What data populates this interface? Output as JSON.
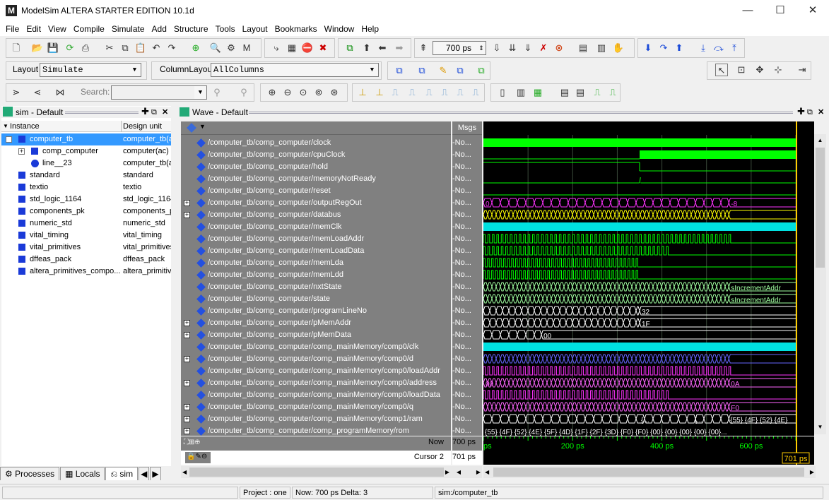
{
  "app": {
    "title": "ModelSim ALTERA STARTER EDITION 10.1d",
    "logo": "M"
  },
  "window_controls": {
    "minimize": "—",
    "maximize": "☐",
    "close": "✕"
  },
  "menu": [
    "File",
    "Edit",
    "View",
    "Compile",
    "Simulate",
    "Add",
    "Structure",
    "Tools",
    "Layout",
    "Bookmarks",
    "Window",
    "Help"
  ],
  "toolbar": {
    "run_length": "700 ps",
    "layout_label": "Layout",
    "layout_value": "Simulate",
    "column_layout_label": "ColumnLayout",
    "column_layout_value": "AllColumns",
    "search_label": "Search:",
    "search_value": ""
  },
  "sim_panel": {
    "title": "sim - Default",
    "col_instance": "Instance",
    "col_design_unit": "Design unit",
    "rows": [
      {
        "instance": "computer_tb",
        "unit": "computer_tb(a",
        "icon": "block",
        "indent": 0,
        "expand": "-",
        "selected": true
      },
      {
        "instance": "comp_computer",
        "unit": "computer(ac)",
        "icon": "block",
        "indent": 1,
        "expand": "+",
        "selected": false
      },
      {
        "instance": "line__23",
        "unit": "computer_tb(a",
        "icon": "process",
        "indent": 1,
        "expand": "",
        "selected": false
      },
      {
        "instance": "standard",
        "unit": "standard",
        "icon": "block",
        "indent": 0,
        "expand": "",
        "selected": false
      },
      {
        "instance": "textio",
        "unit": "textio",
        "icon": "block",
        "indent": 0,
        "expand": "",
        "selected": false
      },
      {
        "instance": "std_logic_1164",
        "unit": "std_logic_1164",
        "icon": "block",
        "indent": 0,
        "expand": "",
        "selected": false
      },
      {
        "instance": "components_pk",
        "unit": "components_p",
        "icon": "block",
        "indent": 0,
        "expand": "",
        "selected": false
      },
      {
        "instance": "numeric_std",
        "unit": "numeric_std",
        "icon": "block",
        "indent": 0,
        "expand": "",
        "selected": false
      },
      {
        "instance": "vital_timing",
        "unit": "vital_timing",
        "icon": "block",
        "indent": 0,
        "expand": "",
        "selected": false
      },
      {
        "instance": "vital_primitives",
        "unit": "vital_primitives",
        "icon": "block",
        "indent": 0,
        "expand": "",
        "selected": false
      },
      {
        "instance": "dffeas_pack",
        "unit": "dffeas_pack",
        "icon": "block",
        "indent": 0,
        "expand": "",
        "selected": false
      },
      {
        "instance": "altera_primitives_compo...",
        "unit": "altera_primitiv",
        "icon": "block",
        "indent": 0,
        "expand": "",
        "selected": false
      }
    ],
    "tabs": [
      "Processes",
      "Locals",
      "sim"
    ]
  },
  "wave": {
    "title": "Wave - Default",
    "msgs_header": "Msgs",
    "now_label": "Now",
    "now_value": "700 ps",
    "cursor_label": "Cursor 2",
    "cursor_value": "701 ps",
    "cursor_flag": "701 ps",
    "time_end_ps": 700,
    "time_labels": [
      "ps",
      "200 ps",
      "400 ps",
      "600 ps"
    ],
    "signals": [
      {
        "name": "/computer_tb/comp_computer/clock",
        "msg": "-No...",
        "expand": false,
        "type": "clockfill",
        "color": "#00ff00"
      },
      {
        "name": "/computer_tb/comp_computer/cpuClock",
        "msg": "-No...",
        "expand": false,
        "type": "late",
        "color": "#00ff00"
      },
      {
        "name": "/computer_tb/comp_computer/hold",
        "msg": "-No...",
        "expand": false,
        "type": "hold",
        "color": "#00ff00"
      },
      {
        "name": "/computer_tb/comp_computer/memoryNotReady",
        "msg": "-No...",
        "expand": false,
        "type": "mnr",
        "color": "#00ff00"
      },
      {
        "name": "/computer_tb/comp_computer/reset",
        "msg": "-No...",
        "expand": false,
        "type": "low",
        "color": "#00ff00"
      },
      {
        "name": "/computer_tb/comp_computer/outputRegOut",
        "msg": "-No...",
        "expand": true,
        "type": "bus",
        "color": "#ff33ff",
        "values": [
          "0",
          "-8"
        ]
      },
      {
        "name": "/computer_tb/comp_computer/databus",
        "msg": "-No...",
        "expand": true,
        "type": "busdense",
        "color": "#ffff00",
        "values": []
      },
      {
        "name": "/computer_tb/comp_computer/memClk",
        "msg": "-No...",
        "expand": false,
        "type": "clockfill",
        "color": "#00e0e0"
      },
      {
        "name": "/computer_tb/comp_computer/memLoadAddr",
        "msg": "-No...",
        "expand": false,
        "type": "pulses",
        "color": "#00ff00"
      },
      {
        "name": "/computer_tb/comp_computer/memLoadData",
        "msg": "-No...",
        "expand": false,
        "type": "pulses2",
        "color": "#00ff00"
      },
      {
        "name": "/computer_tb/comp_computer/memLda",
        "msg": "-No...",
        "expand": false,
        "type": "pulses3",
        "color": "#00ff00"
      },
      {
        "name": "/computer_tb/comp_computer/memLdd",
        "msg": "-No...",
        "expand": false,
        "type": "pulses3",
        "color": "#00ff00"
      },
      {
        "name": "/computer_tb/comp_computer/nxtState",
        "msg": "-No...",
        "expand": false,
        "type": "busdense",
        "color": "#a0ffa0",
        "values": [
          "sIncrementAddr"
        ]
      },
      {
        "name": "/computer_tb/comp_computer/state",
        "msg": "-No...",
        "expand": false,
        "type": "busdense",
        "color": "#a0ffa0",
        "values": [
          "sIncrementAddr"
        ]
      },
      {
        "name": "/computer_tb/comp_computer/programLineNo",
        "msg": "-No...",
        "expand": false,
        "type": "busmed",
        "color": "#ffffff",
        "values": [
          "32"
        ]
      },
      {
        "name": "/computer_tb/comp_computer/pMemAddr",
        "msg": "-No...",
        "expand": true,
        "type": "busmed",
        "color": "#ffffff",
        "values": [
          "1F"
        ]
      },
      {
        "name": "/computer_tb/comp_computer/pMemData",
        "msg": "-No...",
        "expand": true,
        "type": "busshort",
        "color": "#ffffff",
        "values": [
          "00"
        ]
      },
      {
        "name": "/computer_tb/comp_computer/comp_mainMemory/comp0/clk",
        "msg": "-No...",
        "expand": false,
        "type": "clockfill",
        "color": "#00e0e0"
      },
      {
        "name": "/computer_tb/comp_computer/comp_mainMemory/comp0/d",
        "msg": "-No...",
        "expand": true,
        "type": "busdense",
        "color": "#6666ff",
        "values": []
      },
      {
        "name": "/computer_tb/comp_computer/comp_mainMemory/comp0/loadAddr",
        "msg": "-No...",
        "expand": false,
        "type": "pulses",
        "color": "#ff33ff"
      },
      {
        "name": "/computer_tb/comp_computer/comp_mainMemory/comp0/address",
        "msg": "-No...",
        "expand": true,
        "type": "busdense",
        "color": "#ff66ff",
        "values": [
          "00",
          "0A"
        ]
      },
      {
        "name": "/computer_tb/comp_computer/comp_mainMemory/comp0/loadData",
        "msg": "-No...",
        "expand": false,
        "type": "pulses2",
        "color": "#ff33ff"
      },
      {
        "name": "/computer_tb/comp_computer/comp_mainMemory/comp0/q",
        "msg": "-No...",
        "expand": true,
        "type": "busdense",
        "color": "#ff66ff",
        "values": [
          "F0"
        ]
      },
      {
        "name": "/computer_tb/comp_computer/comp_mainMemory/comp1/ram",
        "msg": "-No...",
        "expand": true,
        "type": "busblocks",
        "color": "#ffffff",
        "values": [
          "{...",
          "{...",
          "{55} {4F} {52} {4E}"
        ]
      },
      {
        "name": "/computer_tb/comp_computer/comp_programMemory/rom",
        "msg": "-No...",
        "expand": true,
        "type": "text",
        "color": "#ffffff",
        "values": [
          "{55} {4F} {52} {4E} {5F} {4D} {1F} {2F} {3D} {F0} {F0} {00} {00} {00} {00} {00}..."
        ]
      }
    ]
  },
  "statusbar": {
    "project": "Project : one",
    "now": "Now: 700 ps  Delta: 3",
    "context": "sim:/computer_tb"
  },
  "colors": {
    "wave_bg": "#000000",
    "name_bg": "#808080",
    "cursor": "#ffcc00",
    "grid": "#3a4a3a",
    "selected": "#3399ff"
  }
}
